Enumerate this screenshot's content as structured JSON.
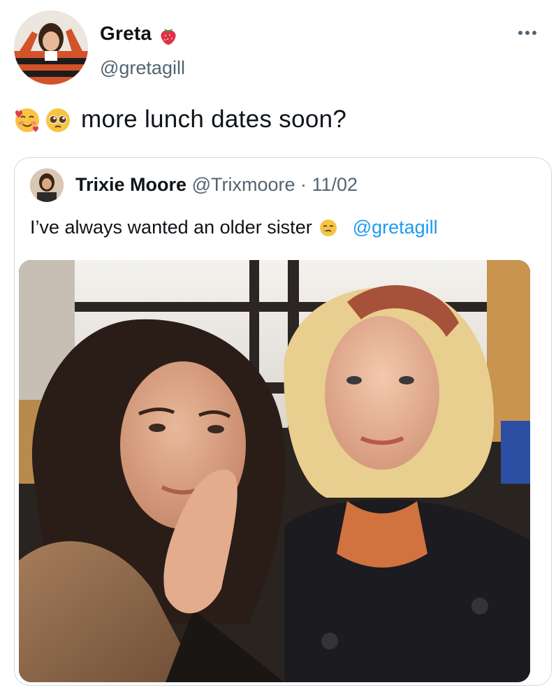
{
  "author": {
    "name": "Greta",
    "name_emoji": "strawberry-emoji",
    "handle": "@gretagill"
  },
  "tweet": {
    "emojis": [
      "smiling-face-with-hearts-emoji",
      "pleading-face-emoji"
    ],
    "text": "more lunch dates soon?"
  },
  "quoted_tweet": {
    "author_name": "Trixie Moore",
    "author_handle": "@Trixmoore",
    "separator": "·",
    "date": "11/02",
    "text": "I’ve always wanted an older sister",
    "emoji": "face-holding-back-tears-emoji",
    "mention": "@gretagill",
    "photo": "selfie-photo"
  },
  "colors": {
    "text_primary": "#0f1419",
    "text_secondary": "#536471",
    "link": "#1d9bf0",
    "border": "#cfd9de"
  }
}
